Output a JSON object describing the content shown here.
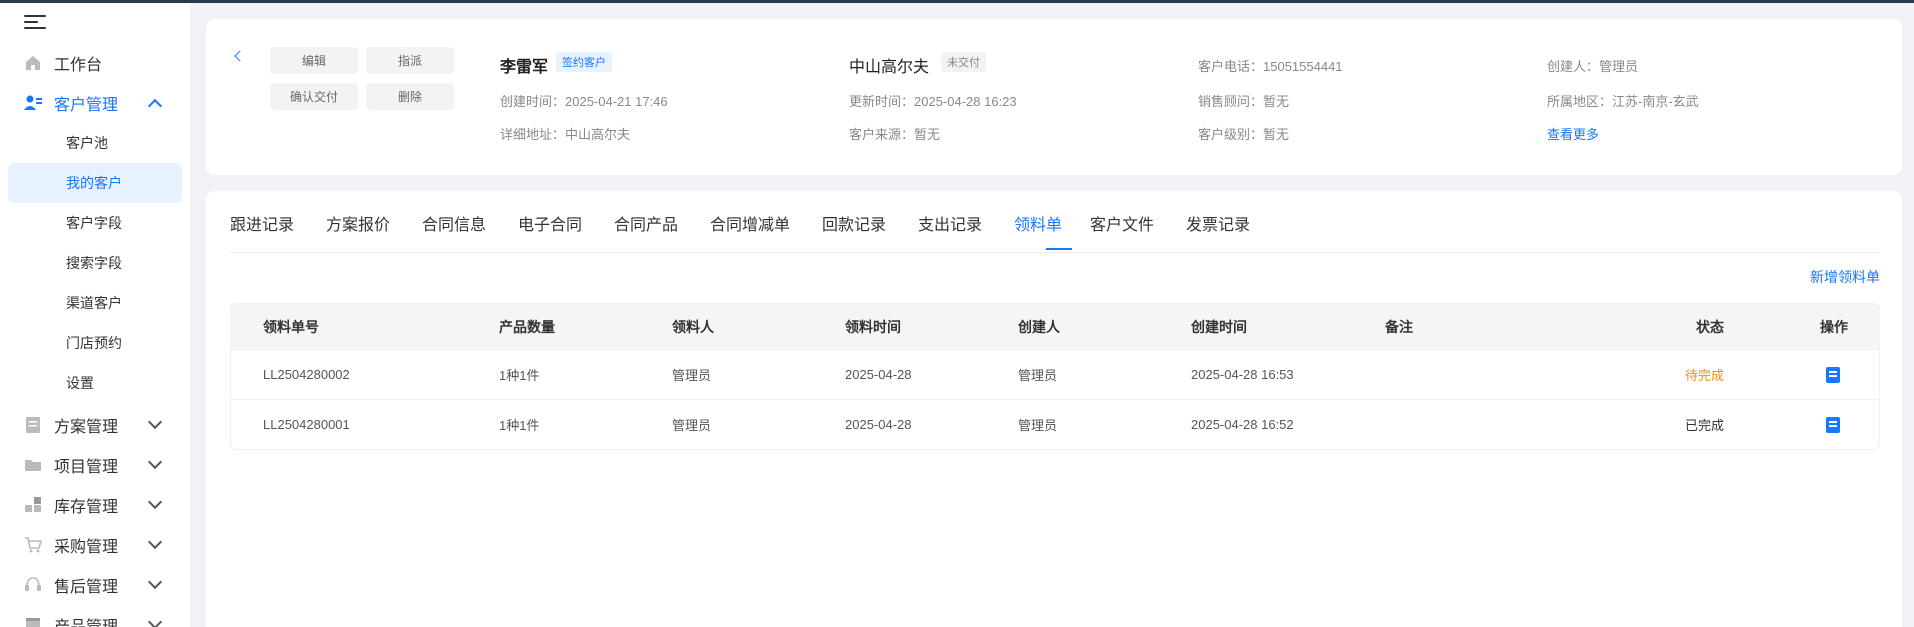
{
  "sidebar": {
    "items": [
      {
        "label": "工作台",
        "icon": "home-icon"
      },
      {
        "label": "客户管理",
        "icon": "user-group-icon"
      },
      {
        "label": "方案管理",
        "icon": "document-icon"
      },
      {
        "label": "项目管理",
        "icon": "folder-icon"
      },
      {
        "label": "库存管理",
        "icon": "boxes-icon"
      },
      {
        "label": "采购管理",
        "icon": "cart-icon"
      },
      {
        "label": "售后管理",
        "icon": "headset-icon"
      },
      {
        "label": "产品管理",
        "icon": "product-icon"
      }
    ],
    "subitems": [
      "客户池",
      "我的客户",
      "客户字段",
      "搜索字段",
      "渠道客户",
      "门店预约",
      "设置"
    ]
  },
  "header": {
    "buttons": {
      "edit": "编辑",
      "assign": "指派",
      "confirm": "确认交付",
      "delete": "删除"
    },
    "customer_name": "李雷军",
    "customer_tag": "签约客户",
    "project_name": "中山高尔夫",
    "project_tag": "未交付",
    "created": "创建时间：2025-04-21 17:46",
    "address": "详细地址：中山高尔夫",
    "updated": "更新时间：2025-04-28 16:23",
    "source": "客户来源：暂无",
    "phone": "客户电话：15051554441",
    "sales": "销售顾问：暂无",
    "level": "客户级别：暂无",
    "creator": "创建人：管理员",
    "region": "所属地区：江苏-南京-玄武",
    "more": "查看更多"
  },
  "tabs": [
    "跟进记录",
    "方案报价",
    "合同信息",
    "电子合同",
    "合同产品",
    "合同增减单",
    "回款记录",
    "支出记录",
    "领料单",
    "客户文件",
    "发票记录"
  ],
  "active_tab": "领料单",
  "add_label": "新增领料单",
  "table": {
    "headers": [
      "领料单号",
      "产品数量",
      "领料人",
      "领料时间",
      "创建人",
      "创建时间",
      "备注",
      "状态",
      "操作"
    ],
    "rows": [
      {
        "no": "LL2504280002",
        "qty": "1种1件",
        "picker": "管理员",
        "date": "2025-04-28",
        "creator": "管理员",
        "created": "2025-04-28 16:53",
        "note": "",
        "status": "待完成"
      },
      {
        "no": "LL2504280001",
        "qty": "1种1件",
        "picker": "管理员",
        "date": "2025-04-28",
        "creator": "管理员",
        "created": "2025-04-28 16:52",
        "note": "",
        "status": "已完成"
      }
    ]
  },
  "colors": {
    "accent": "#1677ff",
    "pending": "#fa8c16"
  }
}
